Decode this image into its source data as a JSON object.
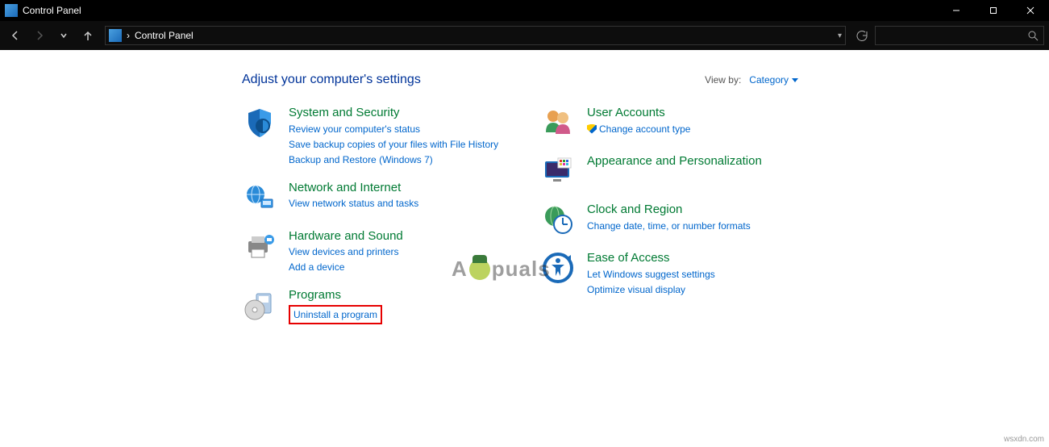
{
  "window": {
    "title": "Control Panel"
  },
  "address": {
    "sep": "›",
    "path": "Control Panel"
  },
  "page": {
    "heading": "Adjust your computer's settings",
    "viewby_label": "View by:",
    "viewby_value": "Category"
  },
  "left": [
    {
      "title": "System and Security",
      "links": [
        {
          "text": "Review your computer's status"
        },
        {
          "text": "Save backup copies of your files with File History"
        },
        {
          "text": "Backup and Restore (Windows 7)"
        }
      ]
    },
    {
      "title": "Network and Internet",
      "links": [
        {
          "text": "View network status and tasks"
        }
      ]
    },
    {
      "title": "Hardware and Sound",
      "links": [
        {
          "text": "View devices and printers"
        },
        {
          "text": "Add a device"
        }
      ]
    },
    {
      "title": "Programs",
      "links": [
        {
          "text": "Uninstall a program",
          "highlighted": true
        }
      ]
    }
  ],
  "right": [
    {
      "title": "User Accounts",
      "links": [
        {
          "text": "Change account type",
          "shielded": true
        }
      ]
    },
    {
      "title": "Appearance and Personalization",
      "links": []
    },
    {
      "title": "Clock and Region",
      "links": [
        {
          "text": "Change date, time, or number formats"
        }
      ]
    },
    {
      "title": "Ease of Access",
      "links": [
        {
          "text": "Let Windows suggest settings"
        },
        {
          "text": "Optimize visual display"
        }
      ]
    }
  ],
  "watermark": {
    "pre": "A",
    "post": "puals"
  },
  "credit": "wsxdn.com"
}
